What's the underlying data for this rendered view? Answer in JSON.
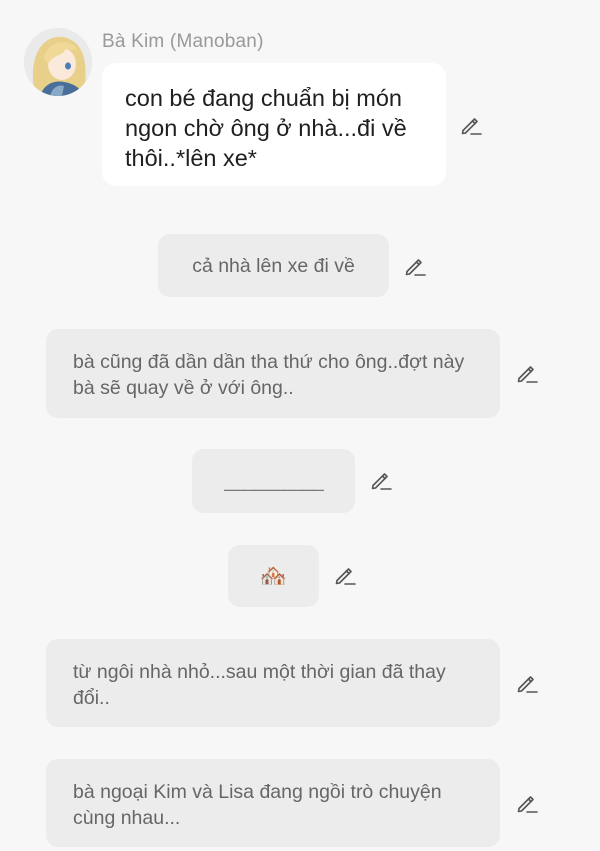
{
  "sender": {
    "name": "Bà Kim (Manoban)"
  },
  "messages": [
    {
      "text": "con bé đang chuẩn bị món ngon chờ ông ở nhà...đi về thôi..*lên xe*"
    },
    {
      "text": "cả nhà lên xe đi về"
    },
    {
      "text": "bà cũng đã dần dần tha thứ cho ông..đợt này bà sẽ quay về ở với ông.."
    },
    {
      "text": "__________"
    },
    {
      "text": "🏘️"
    },
    {
      "text": "từ ngôi nhà nhỏ...sau một thời gian đã thay đổi.."
    },
    {
      "text": "bà ngoại Kim và Lisa đang ngồi trò chuyện cùng nhau..."
    }
  ],
  "icons": {
    "edit": "pencil-edit-icon",
    "avatar": "anime-girl-avatar"
  },
  "colors": {
    "background": "#f7f7f7",
    "main_bubble": "#ffffff",
    "narration_bubble": "#ececec",
    "name_text": "#999999",
    "main_text": "#1f1f1f"
  }
}
